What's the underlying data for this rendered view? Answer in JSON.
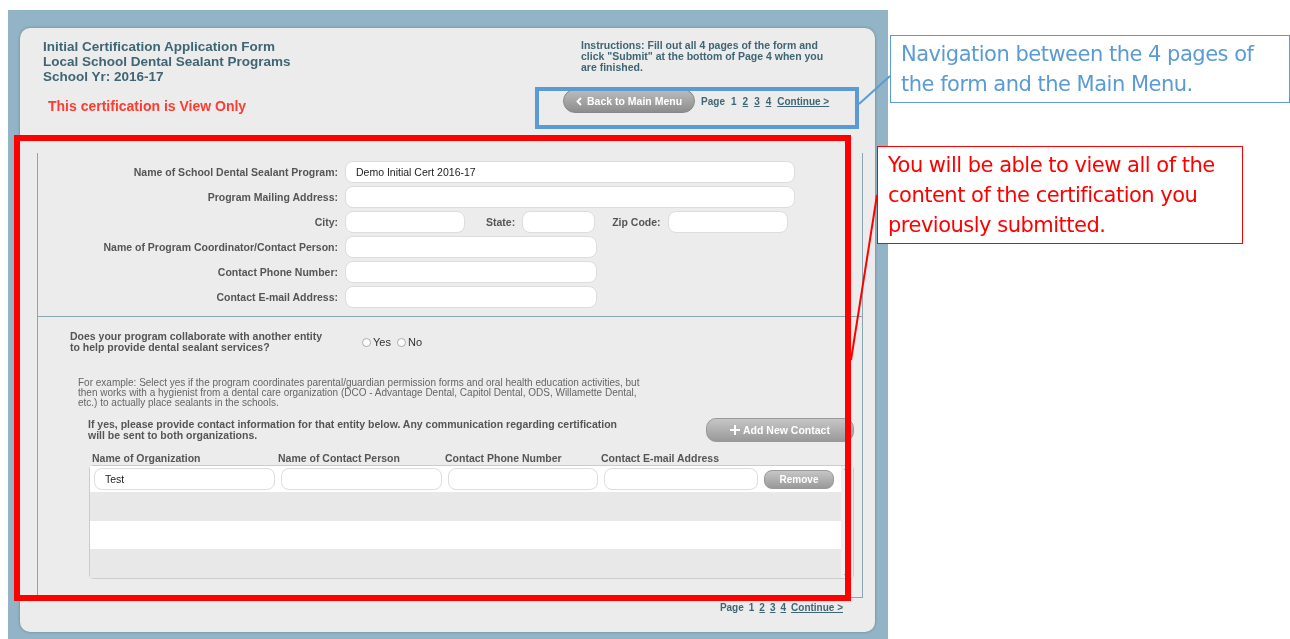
{
  "header": {
    "title_lines": [
      "Initial Certification Application Form",
      "Local School Dental Sealant Programs",
      "School Yr: 2016-17"
    ],
    "status": "This certification is View Only",
    "instructions": "Instructions: Fill out all 4 pages of the form and click \"Submit\" at the bottom of Page 4 when you are finished.",
    "back_button": "Back to Main Menu",
    "nav": {
      "page_label": "Page",
      "pages": [
        {
          "label": "1",
          "selected": true
        },
        {
          "label": "2",
          "selected": false
        },
        {
          "label": "3",
          "selected": false
        },
        {
          "label": "4",
          "selected": false
        }
      ],
      "continue": "Continue >"
    }
  },
  "program_fields": [
    {
      "kind": "wide",
      "fields": [
        {
          "label": "Name of School Dental Sealant Program:",
          "value": "Demo Initial Cert 2016-17"
        }
      ]
    },
    {
      "kind": "wide",
      "fields": [
        {
          "label": "Program Mailing Address:"
        }
      ]
    },
    {
      "kind": "address",
      "fields": [
        {
          "label": "City:"
        },
        {
          "label": "State:"
        },
        {
          "label": "Zip Code:"
        }
      ]
    },
    {
      "kind": "medium",
      "fields": [
        {
          "label": "Name of Program Coordinator/Contact Person:"
        }
      ]
    },
    {
      "kind": "medium",
      "fields": [
        {
          "label": "Contact Phone Number:"
        }
      ]
    },
    {
      "kind": "medium",
      "fields": [
        {
          "label": "Contact E-mail Address:"
        }
      ]
    }
  ],
  "collaboration": {
    "question": "Does your program collaborate with another entity to help provide dental sealant services?",
    "options": [
      {
        "label": "Yes",
        "selected": false
      },
      {
        "label": "No",
        "selected": false
      }
    ],
    "example": "For example: Select yes if the program coordinates parental/guardian permission forms and oral health education activities, but then works with a hygienist from a dental care organization (DCO - Advantage Dental, Capitol Dental, ODS, Willamette Dental, etc.) to actually place sealants in the schools.",
    "contact_note": "If yes, please provide contact information for that entity below. Any communication regarding certification will be sent to both organizations.",
    "add_button": "Add New Contact"
  },
  "contacts": {
    "columns": [
      "Name of Organization",
      "Name of Contact Person",
      "Contact Phone Number",
      "Contact E-mail Address"
    ],
    "rows": [
      {
        "values": [
          "Test"
        ],
        "remove": "Remove"
      }
    ]
  },
  "footer_nav": {
    "page_label": "Page",
    "pages": [
      {
        "label": "1",
        "selected": true
      },
      {
        "label": "2",
        "selected": false
      },
      {
        "label": "3",
        "selected": false
      },
      {
        "label": "4",
        "selected": false
      }
    ],
    "continue": "Continue >"
  },
  "annotations": [
    {
      "text": "Navigation between the 4 pages of the form and the Main Menu.",
      "color": "#5b9bd5"
    },
    {
      "text": "You will be able to view all of the content of the certification you previously submitted.",
      "color": "#ff0000"
    }
  ]
}
